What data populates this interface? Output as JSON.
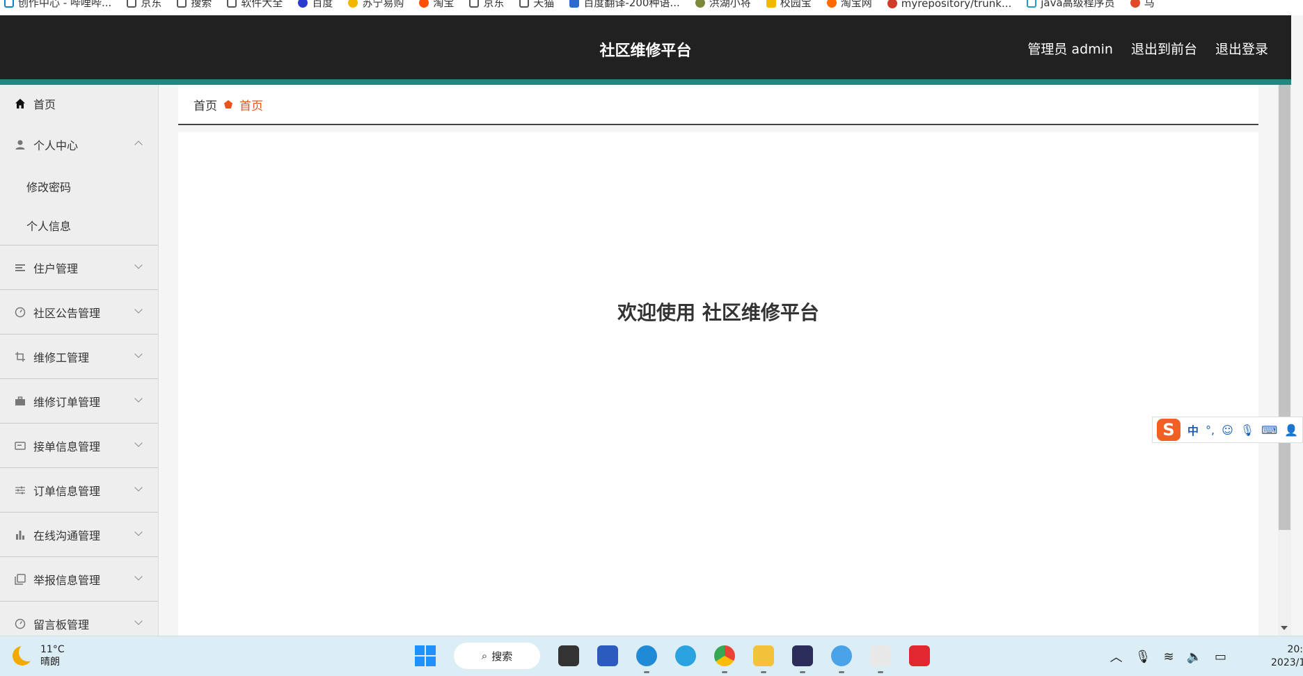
{
  "bookmarks": [
    "创作中心 - 哔哩哔...",
    "京东",
    "搜索",
    "软件大全",
    "百度",
    "苏宁易购",
    "淘宝",
    "京东",
    "天猫",
    "百度翻译-200种语...",
    "洪湖小将",
    "校园宝",
    "淘宝网",
    "myrepository/trunk...",
    "java高级程序员",
    "马"
  ],
  "header": {
    "brand": "社区维修平台",
    "admin_label": "管理员 admin",
    "exit_front": "退出到前台",
    "logout": "退出登录",
    "accent_color": "#1b8b7f"
  },
  "sidebar": {
    "home": "首页",
    "personal": "个人中心",
    "personal_sub": [
      "修改密码",
      "个人信息"
    ],
    "items": [
      "住户管理",
      "社区公告管理",
      "维修工管理",
      "维修订单管理",
      "接单信息管理",
      "订单信息管理",
      "在线沟通管理",
      "举报信息管理",
      "留言板管理"
    ]
  },
  "breadcrumb": {
    "home": "首页",
    "current": "首页",
    "current_color": "#e8541c"
  },
  "main": {
    "welcome": "欢迎使用 社区维修平台"
  },
  "ime": {
    "lang": "中",
    "punct": "°,"
  },
  "taskbar": {
    "temp": "11°C",
    "weather": "晴朗",
    "search": "搜索",
    "time": "20:",
    "date": "2023/1"
  }
}
